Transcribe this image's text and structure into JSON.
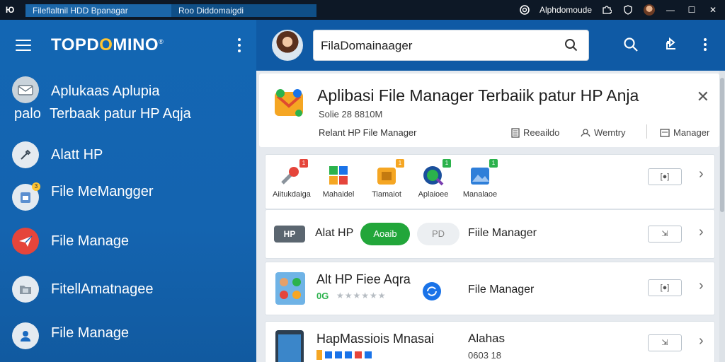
{
  "titlebar": {
    "app_icon": "Ю",
    "tab_primary": "Fileflaltnil HDD Bpanagar",
    "tab_secondary": "Roo Diddomaigdi",
    "account_label": "Alphdomoude",
    "icons": [
      "spiral-icon",
      "puzzle-icon",
      "shield-icon",
      "avatar",
      "minimize-icon",
      "maximize-icon",
      "close-icon"
    ],
    "minimize": "—",
    "maximize": "☐",
    "close": "✕"
  },
  "sidebar": {
    "logo_pre": "TOPD",
    "logo_o": "O",
    "logo_post": "MINO",
    "logo_mark": "®",
    "items": [
      {
        "line1": "Aplukaas Aplupia",
        "prefix": "palo",
        "line2": "Terbaak patur HP Aqja",
        "icon": "mail-icon"
      },
      {
        "label": "Alatt HP",
        "icon": "tools-icon"
      },
      {
        "label": "File MeMangger",
        "icon": "file-icon",
        "badge": "3"
      },
      {
        "label": "File Manage",
        "icon": "send-icon"
      },
      {
        "label": "FitellAmatnagee",
        "icon": "folder-icon"
      },
      {
        "label": "File Manage",
        "icon": "user-icon"
      }
    ]
  },
  "search": {
    "value": "FilaDomainaager"
  },
  "hero": {
    "title": "Aplibasi File Manager Terbaiik patur HP Anja",
    "subtitle": "Solie 28 8810M",
    "meta": "Relant HP File Manager",
    "actions": [
      "Reeaildo",
      "Wemtry",
      "Manager"
    ],
    "close": "✕"
  },
  "apps_row": {
    "items": [
      {
        "label": "Aiitukdaiga",
        "badge": "1"
      },
      {
        "label": "Mahaidel",
        "badge": ""
      },
      {
        "label": "Tiamaiot",
        "badge": "1"
      },
      {
        "label": "Aplaioee",
        "badge": "1"
      },
      {
        "label": "Manalaoe",
        "badge": "1"
      }
    ],
    "button": "[●]",
    "chevron": "›"
  },
  "row2": {
    "badge": "HP",
    "label": "Alat HP",
    "pill_green": "Aoaib",
    "pill_grey": "PD",
    "right_label": "Fiile Manager",
    "button": "⇲",
    "chevron": "›"
  },
  "row3": {
    "title": "Alt HP Fiee Aqra",
    "rating_prefix": "0G",
    "stars": "★★★★★★",
    "right_label": "File Manager",
    "button": "[●]",
    "chevron": "›"
  },
  "row4": {
    "title": "HapMassiois Mnasai",
    "right_label": "Alahas",
    "right_sub": "0603 18",
    "button": "⇲",
    "chevron": "›"
  },
  "colors": {
    "sidebar_blue": "#1366b3",
    "accent_yellow": "#ffc531",
    "green_pill": "#22a63a",
    "titlebar": "#0d1826"
  }
}
